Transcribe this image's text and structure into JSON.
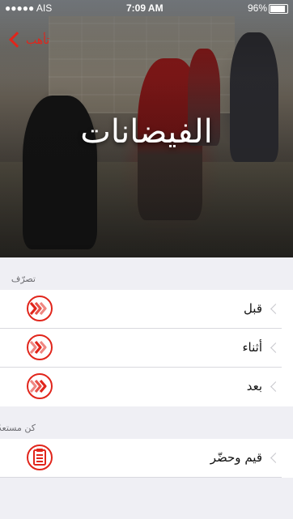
{
  "status_bar": {
    "carrier": "●●●●● AIS",
    "time": "7:09 AM",
    "battery": "96%",
    "battery_level": 0.96
  },
  "header": {
    "back_label": "تأهب",
    "title": "الفيضانات"
  },
  "sections": [
    {
      "title": "تصرّف",
      "rows": [
        {
          "label": "قبل",
          "icon": "chevrons-circle-icon"
        },
        {
          "label": "أثناء",
          "icon": "chevrons-circle-icon"
        },
        {
          "label": "بعد",
          "icon": "chevrons-circle-icon"
        }
      ]
    },
    {
      "title": "كن مستعدًا",
      "rows": [
        {
          "label": "قيم وحضّر",
          "icon": "checklist-icon"
        }
      ]
    }
  ],
  "colors": {
    "accent": "#e1251b",
    "background": "#efeff4",
    "separator": "#d9d9de"
  }
}
